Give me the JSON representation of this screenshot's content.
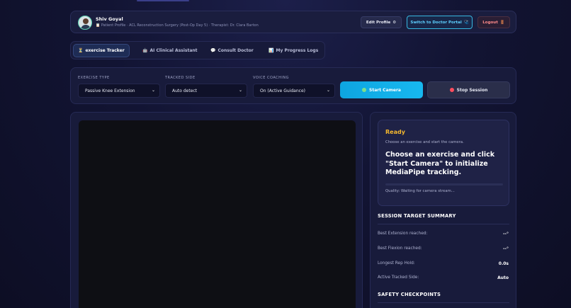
{
  "header": {
    "user_name": "Shiv Goyal",
    "user_meta": "📋 Patient Profile · ACL Reconstruction Surgery (Post-Op Day 5) · Therapist: Dr. Clara Barton",
    "edit_profile_label": "Edit Profile",
    "edit_profile_icon": "⚙",
    "doctor_portal_label": "Switch to Doctor Portal",
    "doctor_portal_icon": "🩺",
    "logout_label": "Logout",
    "logout_icon": "🚪"
  },
  "tabs": [
    {
      "label": "exercise Tracker",
      "icon": "⏳",
      "active": true
    },
    {
      "label": "AI Clinical Assistant",
      "icon": "🤖",
      "active": false
    },
    {
      "label": "Consult Doctor",
      "icon": "💬",
      "active": false
    },
    {
      "label": "My Progress Logs",
      "icon": "📊",
      "active": false
    }
  ],
  "controls": {
    "exercise_type_label": "Exercise Type",
    "exercise_type_value": "Passive Knee Extension",
    "tracked_side_label": "Tracked Side",
    "tracked_side_value": "Auto detect",
    "voice_coaching_label": "Voice Coaching",
    "voice_coaching_value": "On (Active Guidance)",
    "start_label": "Start Camera",
    "stop_label": "Stop Session"
  },
  "status": {
    "title": "Ready",
    "subtitle": "Choose an exercise and start the camera.",
    "message": "Choose an exercise and click \"Start Camera\" to initialize MediaPipe tracking.",
    "quality_text": "Quality: Waiting for camera stream...",
    "quality_level": 0
  },
  "summary": {
    "title": "SESSION TARGET SUMMARY",
    "items": [
      {
        "label": "Best Extension reached:",
        "value": "--°"
      },
      {
        "label": "Best Flexion reached:",
        "value": "--°"
      },
      {
        "label": "Longest Rep Hold:",
        "value": "0.0s"
      },
      {
        "label": "Active Tracked Side:",
        "value": "Auto"
      }
    ]
  },
  "safety": {
    "title": "SAFETY CHECKPOINTS"
  },
  "colors": {
    "accent": "#17b8f0",
    "status_ready": "#f5b82e",
    "logout": "#ff8a8a",
    "background": "#121433"
  }
}
